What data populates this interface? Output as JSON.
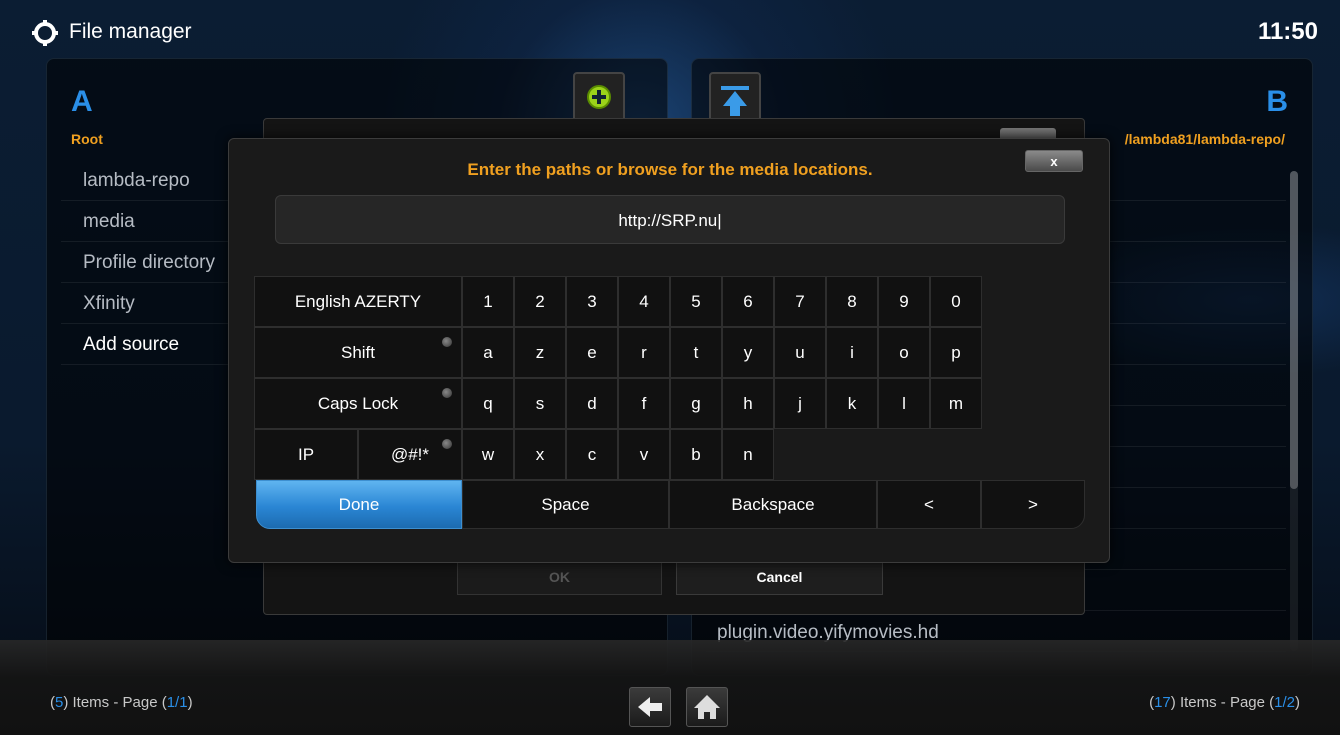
{
  "header": {
    "title": "File manager",
    "clock": "11:50",
    "icon": "gear-icon"
  },
  "panel_a": {
    "letter": "A",
    "path": "Root",
    "items": [
      "lambda-repo",
      "media",
      "Profile directory",
      "Xfinity",
      "Add source"
    ],
    "count_prefix": "(",
    "count_value": "5",
    "count_mid": ") Items - Page (",
    "page": "1/1",
    "count_suffix": ")"
  },
  "panel_b": {
    "letter": "B",
    "path": "/lambda81/lambda-repo/",
    "visible_item": "plugin.video.yifymovies.hd",
    "count_value": "17",
    "page": "1/2"
  },
  "source_dialog": {
    "ok_label": "OK",
    "cancel_label": "Cancel"
  },
  "keyboard": {
    "heading": "Enter the paths or browse for the media locations.",
    "close_label": "x",
    "input_value": "http://SRP.nu|",
    "layout_label": "English AZERTY",
    "shift_label": "Shift",
    "capslock_label": "Caps Lock",
    "ip_label": "IP",
    "symbols_label": "@#!*",
    "row1": [
      "1",
      "2",
      "3",
      "4",
      "5",
      "6",
      "7",
      "8",
      "9",
      "0"
    ],
    "row2": [
      "a",
      "z",
      "e",
      "r",
      "t",
      "y",
      "u",
      "i",
      "o",
      "p"
    ],
    "row3": [
      "q",
      "s",
      "d",
      "f",
      "g",
      "h",
      "j",
      "k",
      "l",
      "m"
    ],
    "row4": [
      "w",
      "x",
      "c",
      "v",
      "b",
      "n"
    ],
    "done_label": "Done",
    "space_label": "Space",
    "backspace_label": "Backspace",
    "left_label": "<",
    "right_label": ">"
  },
  "colors": {
    "accent_blue": "#2a8fe8",
    "accent_orange": "#f0a020"
  }
}
